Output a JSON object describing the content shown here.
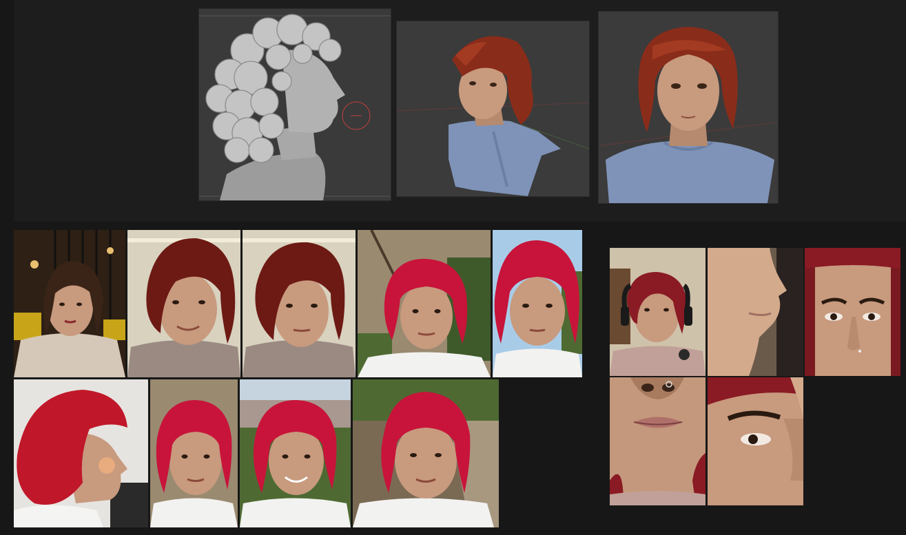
{
  "canvas": {
    "background": "#171717"
  },
  "renders": [
    {
      "name": "render-mesh-profile",
      "kind": "untextured-mesh"
    },
    {
      "name": "render-textured-three-quarter",
      "kind": "textured-mesh"
    },
    {
      "name": "render-textured-front",
      "kind": "textured-mesh"
    }
  ],
  "reference_photos": {
    "row1": [
      {
        "name": "photo-restaurant-selfie",
        "hair": "#3a2418"
      },
      {
        "name": "photo-selfie-smile",
        "hair": "#6d1a14"
      },
      {
        "name": "photo-selfie-neutral",
        "hair": "#6d1a14"
      },
      {
        "name": "photo-park-front",
        "hair": "#c8143a"
      },
      {
        "name": "photo-sky-front",
        "hair": "#c8143a"
      }
    ],
    "row2": [
      {
        "name": "photo-side-profile",
        "hair": "#c0182a"
      },
      {
        "name": "photo-stone-wall",
        "hair": "#c8143a"
      },
      {
        "name": "photo-city-view",
        "hair": "#c8143a"
      },
      {
        "name": "photo-park-path",
        "hair": "#c8143a"
      }
    ]
  },
  "detail_photos": [
    {
      "name": "photo-headset-selfie"
    },
    {
      "name": "photo-nose-profile-closeup"
    },
    {
      "name": "photo-eyes-closeup"
    },
    {
      "name": "photo-mouth-closeup"
    },
    {
      "name": "photo-eye-side-closeup"
    }
  ],
  "colors": {
    "skin": "#c89a7e",
    "skin_shadow": "#9e7258",
    "red_hair": "#c8143a",
    "dark_red_hair": "#6d1a14",
    "shirt_blue": "#7f93b8",
    "viewport_gray": "#3b3b3b"
  }
}
